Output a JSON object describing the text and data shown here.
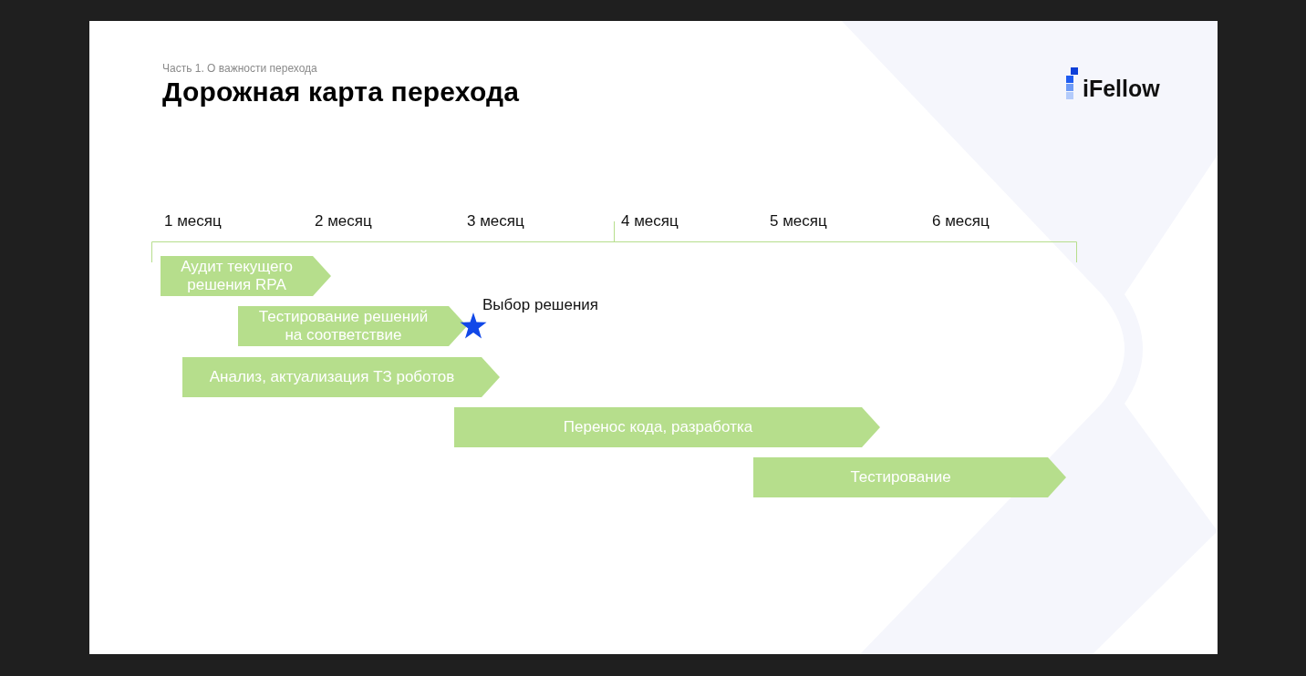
{
  "slide": {
    "section": "Часть 1. О важности перехода",
    "title": "Дорожная карта перехода",
    "logo": "iFellow"
  },
  "timeline": {
    "months": [
      "1 месяц",
      "2 месяц",
      "3 месяц",
      "4 месяц",
      "5 месяц",
      "6 месяц"
    ],
    "tasks": [
      {
        "label": "Аудит текущего\nрешения RPA"
      },
      {
        "label": "Тестирование решений\nна соответствие"
      },
      {
        "label": "Анализ, актуализация ТЗ роботов"
      },
      {
        "label": "Перенос кода, разработка"
      },
      {
        "label": "Тестирование"
      }
    ],
    "milestone": {
      "label": "Выбор решения"
    }
  }
}
